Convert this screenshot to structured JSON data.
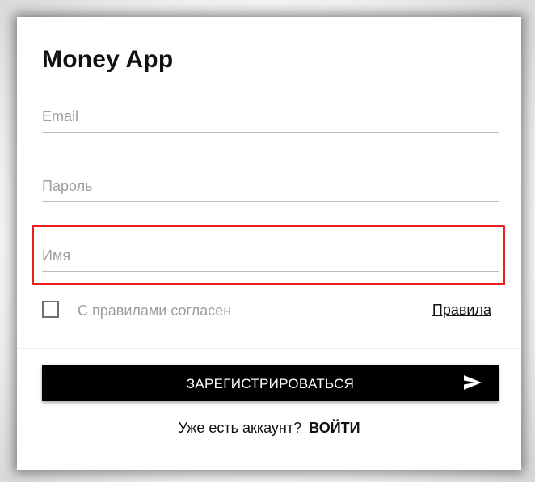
{
  "app": {
    "title": "Money App"
  },
  "form": {
    "email": {
      "placeholder": "Email",
      "value": ""
    },
    "password": {
      "placeholder": "Пароль",
      "value": ""
    },
    "name": {
      "placeholder": "Имя",
      "value": ""
    },
    "agree": {
      "label": "С правилами согласен",
      "checked": false
    },
    "rules_link": "Правила",
    "submit_label": "ЗАРЕГИСТРИРОВАТЬСЯ",
    "submit_icon": "send-icon"
  },
  "footer": {
    "prompt": "Уже есть аккаунт?",
    "login_link": "ВОЙТИ"
  },
  "colors": {
    "highlight": "#ea1f1f",
    "button_bg": "#000000",
    "button_text": "#ffffff"
  }
}
